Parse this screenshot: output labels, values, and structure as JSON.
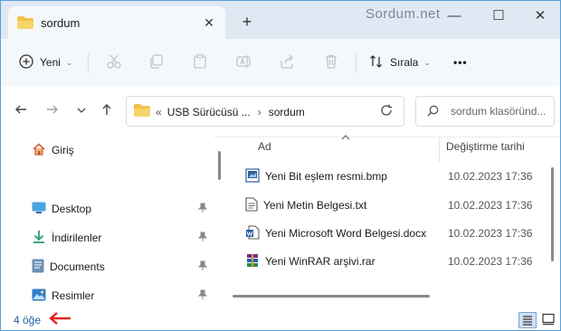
{
  "window": {
    "tab_title": "sordum",
    "new_tab": "+",
    "watermark": "Sordum.net",
    "minimize": "—",
    "maximize": "☐",
    "close": "✕"
  },
  "toolbar": {
    "new_label": "Yeni",
    "sort_label": "Sırala",
    "more": "•••",
    "icons": [
      "cut-icon",
      "copy-icon",
      "paste-icon",
      "rename-icon",
      "share-icon",
      "delete-icon"
    ]
  },
  "address": {
    "prefix": "«",
    "crumbs": [
      "USB Sürücüsü ...",
      "sordum"
    ],
    "search_placeholder": "sordum klasöründ..."
  },
  "navpane": {
    "items": [
      {
        "label": "Giriş",
        "icon": "home-icon",
        "pinned": false
      },
      {
        "label": "Desktop",
        "icon": "desktop-icon",
        "pinned": true
      },
      {
        "label": "İndirilenler",
        "icon": "download-icon",
        "pinned": true
      },
      {
        "label": "Documents",
        "icon": "documents-icon",
        "pinned": true
      },
      {
        "label": "Resimler",
        "icon": "pictures-icon",
        "pinned": true
      }
    ]
  },
  "filelist": {
    "columns": {
      "name": "Ad",
      "modified": "Değiştirme tarihi"
    },
    "files": [
      {
        "name": "Yeni Bit eşlem resmi.bmp",
        "date": "10.02.2023 17:36",
        "icon": "bitmap-file-icon"
      },
      {
        "name": "Yeni Metin Belgesi.txt",
        "date": "10.02.2023 17:36",
        "icon": "text-file-icon"
      },
      {
        "name": "Yeni Microsoft Word Belgesi.docx",
        "date": "10.02.2023 17:36",
        "icon": "word-file-icon"
      },
      {
        "name": "Yeni WinRAR arşivi.rar",
        "date": "10.02.2023 17:36",
        "icon": "winrar-file-icon"
      }
    ]
  },
  "status": {
    "item_count": "4 öğe"
  },
  "colors": {
    "accent": "#1f5fa8",
    "annotation_arrow": "#e8221b",
    "folder": "#f0c24b"
  }
}
